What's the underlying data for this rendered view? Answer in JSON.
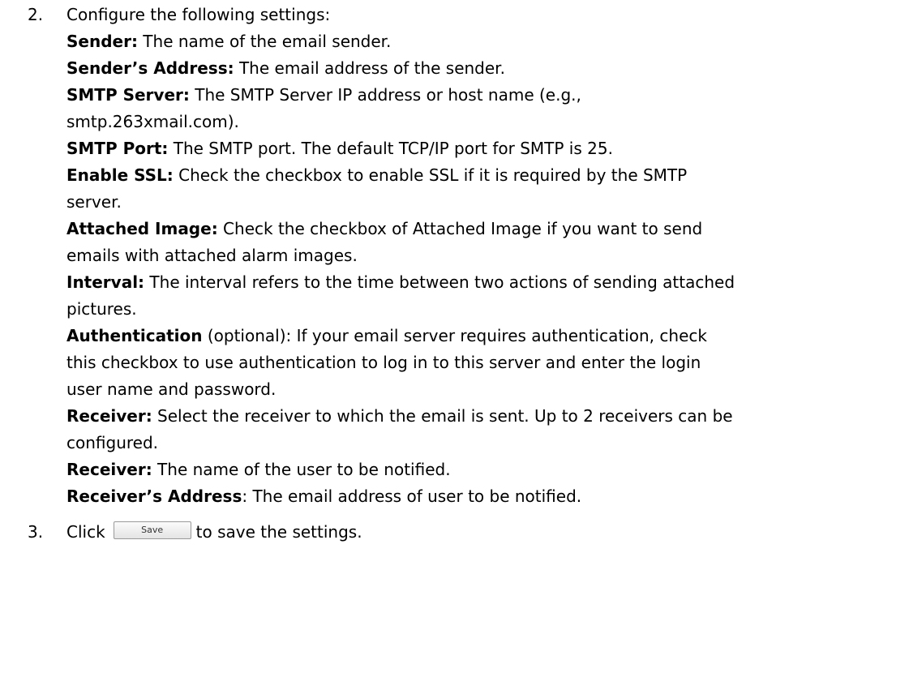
{
  "step2": {
    "number": "2.",
    "intro": "Configure the following settings:",
    "items": [
      {
        "term": "Sender:",
        "lines": [
          " The name of the email sender."
        ]
      },
      {
        "term": "Sender’s Address:",
        "lines": [
          " The email address of the sender."
        ]
      },
      {
        "term": "SMTP Server:",
        "lines": [
          " The SMTP Server IP address or host name (e.g.,",
          "smtp.263xmail.com)."
        ]
      },
      {
        "term": "SMTP Port:",
        "lines": [
          " The SMTP port. The default TCP/IP port for SMTP is 25."
        ]
      },
      {
        "term": "Enable SSL:",
        "lines": [
          " Check the checkbox to enable SSL if it is required by the SMTP",
          "server."
        ]
      },
      {
        "term": "Attached Image:",
        "lines": [
          " Check the checkbox of Attached Image if you want to send",
          "emails with attached alarm images."
        ]
      },
      {
        "term": "Interval:",
        "lines": [
          " The interval refers to the time between two actions of sending attached",
          "pictures."
        ]
      },
      {
        "term": "Authentication",
        "lines": [
          " (optional): If your email server requires authentication, check",
          "this checkbox to use authentication to log in to this server and enter the login",
          "user name and password."
        ]
      },
      {
        "term": "Receiver:",
        "lines": [
          " Select the receiver to which the email is sent. Up to 2 receivers can be",
          "configured."
        ]
      },
      {
        "term": "Receiver:",
        "lines": [
          " The name of the user to be notified."
        ]
      },
      {
        "term": "Receiver’s Address",
        "lines": [
          ": The email address of user to be notified."
        ]
      }
    ]
  },
  "step3": {
    "number": "3.",
    "before": "Click",
    "button_label": "Save",
    "after": "to save the settings."
  }
}
